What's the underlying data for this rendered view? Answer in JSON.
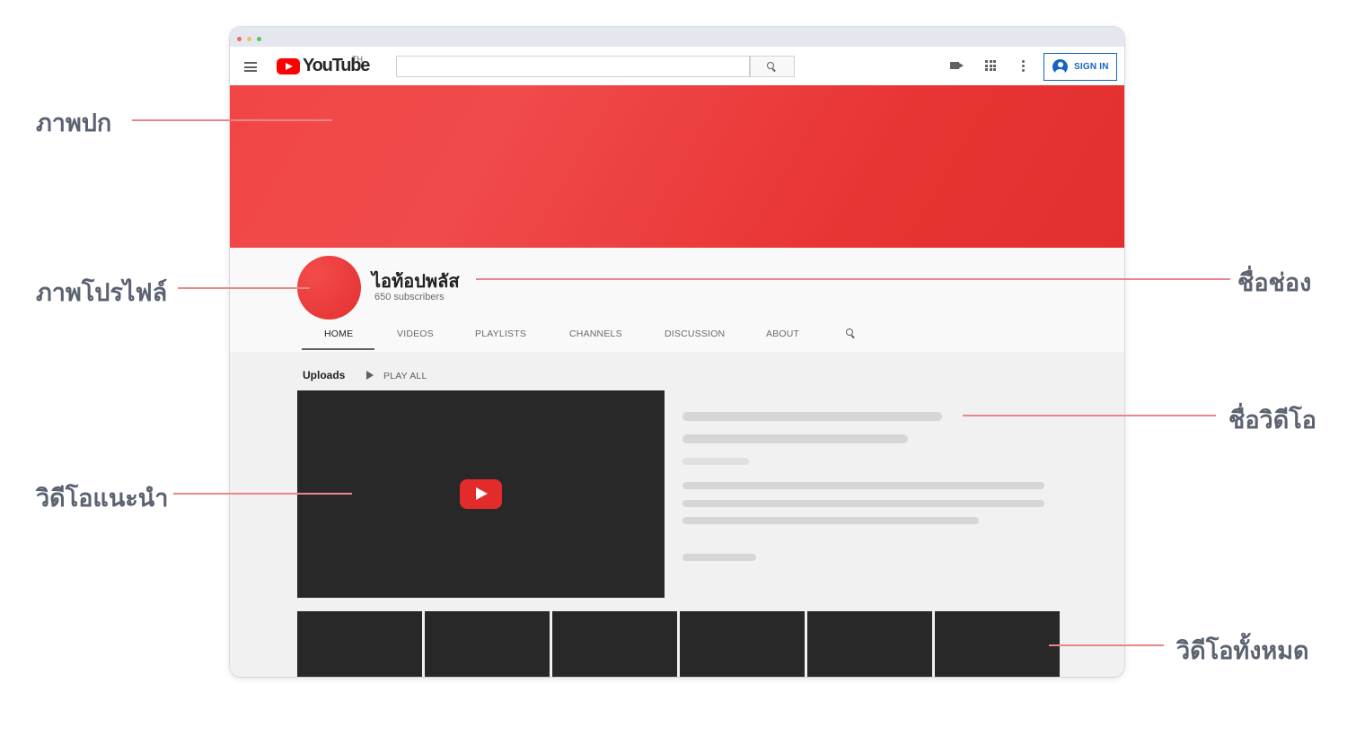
{
  "youtube": {
    "logo_text": "YouTube",
    "country_code": "TH",
    "search_placeholder": "",
    "sign_in_label": "SIGN IN"
  },
  "channel": {
    "name": "ไอท้อปพลัส",
    "subscribers": "650 subscribers",
    "tabs": [
      "HOME",
      "VIDEOS",
      "PLAYLISTS",
      "CHANNELS",
      "DISCUSSION",
      "ABOUT"
    ],
    "active_tab": "HOME"
  },
  "content": {
    "section_title": "Uploads",
    "play_all_label": "PLAY ALL"
  },
  "callouts": {
    "cover": "ภาพปก",
    "profile": "ภาพโปรไฟล์",
    "channel_name": "ชื่อช่อง",
    "featured_video": "วิดีโอแนะนำ",
    "video_title": "ชื่อวิดีโอ",
    "all_videos": "วิดีโอทั้งหมด"
  },
  "colors": {
    "banner": "#f04646",
    "callout_line": "#e8878a",
    "callout_text": "#5b6270",
    "sign_in": "#1565c0",
    "video_bg": "#282828"
  }
}
